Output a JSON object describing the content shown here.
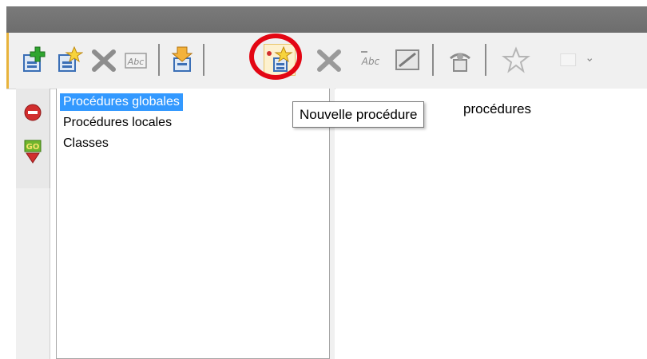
{
  "toolbar": {
    "buttons": [
      {
        "icon": "new-module-icon"
      },
      {
        "icon": "new-item-icon"
      },
      {
        "icon": "delete-icon"
      },
      {
        "icon": "rename-icon"
      },
      {
        "icon": "import-icon"
      },
      {
        "icon": "new-procedure-icon"
      },
      {
        "icon": "delete-procedure-icon"
      },
      {
        "icon": "rename-procedure-icon"
      },
      {
        "icon": "edit-icon"
      },
      {
        "icon": "inspect-icon"
      },
      {
        "icon": "favorite-star-icon"
      },
      {
        "icon": "more-dropdown-icon"
      }
    ],
    "highlight_color": "#e30613"
  },
  "side_rail": {
    "stop_icon": "stop-icon",
    "go_icon": "go-icon"
  },
  "list": {
    "items": [
      "Procédures globales",
      "Procédures locales",
      "Classes"
    ],
    "selected_index": 0,
    "selection_color": "#3399ff"
  },
  "main": {
    "heading": "procédures"
  },
  "tooltip": {
    "text": "Nouvelle procédure"
  }
}
